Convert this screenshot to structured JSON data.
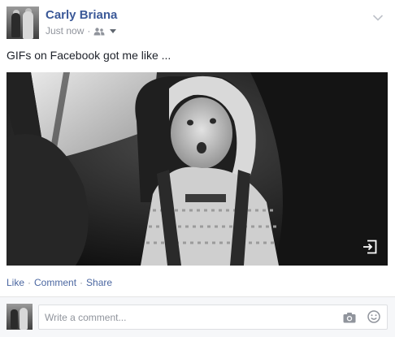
{
  "post": {
    "author": "Carly Briana",
    "timestamp": "Just now",
    "separator": "·",
    "audience_icon": "friends-icon",
    "text": "GIFs on Facebook got me like ..."
  },
  "media": {
    "kind": "gif",
    "overlay_icon": "share-arrow-icon"
  },
  "actions": {
    "like": "Like",
    "comment": "Comment",
    "share": "Share",
    "separator": "·"
  },
  "comment_box": {
    "placeholder": "Write a comment...",
    "value": "",
    "camera_icon": "camera-icon",
    "emoji_icon": "smiley-icon"
  },
  "colors": {
    "link_blue": "#3b5998",
    "action_blue": "#4b67a1",
    "meta_gray": "#90949c",
    "comment_bg": "#f6f7f9"
  }
}
